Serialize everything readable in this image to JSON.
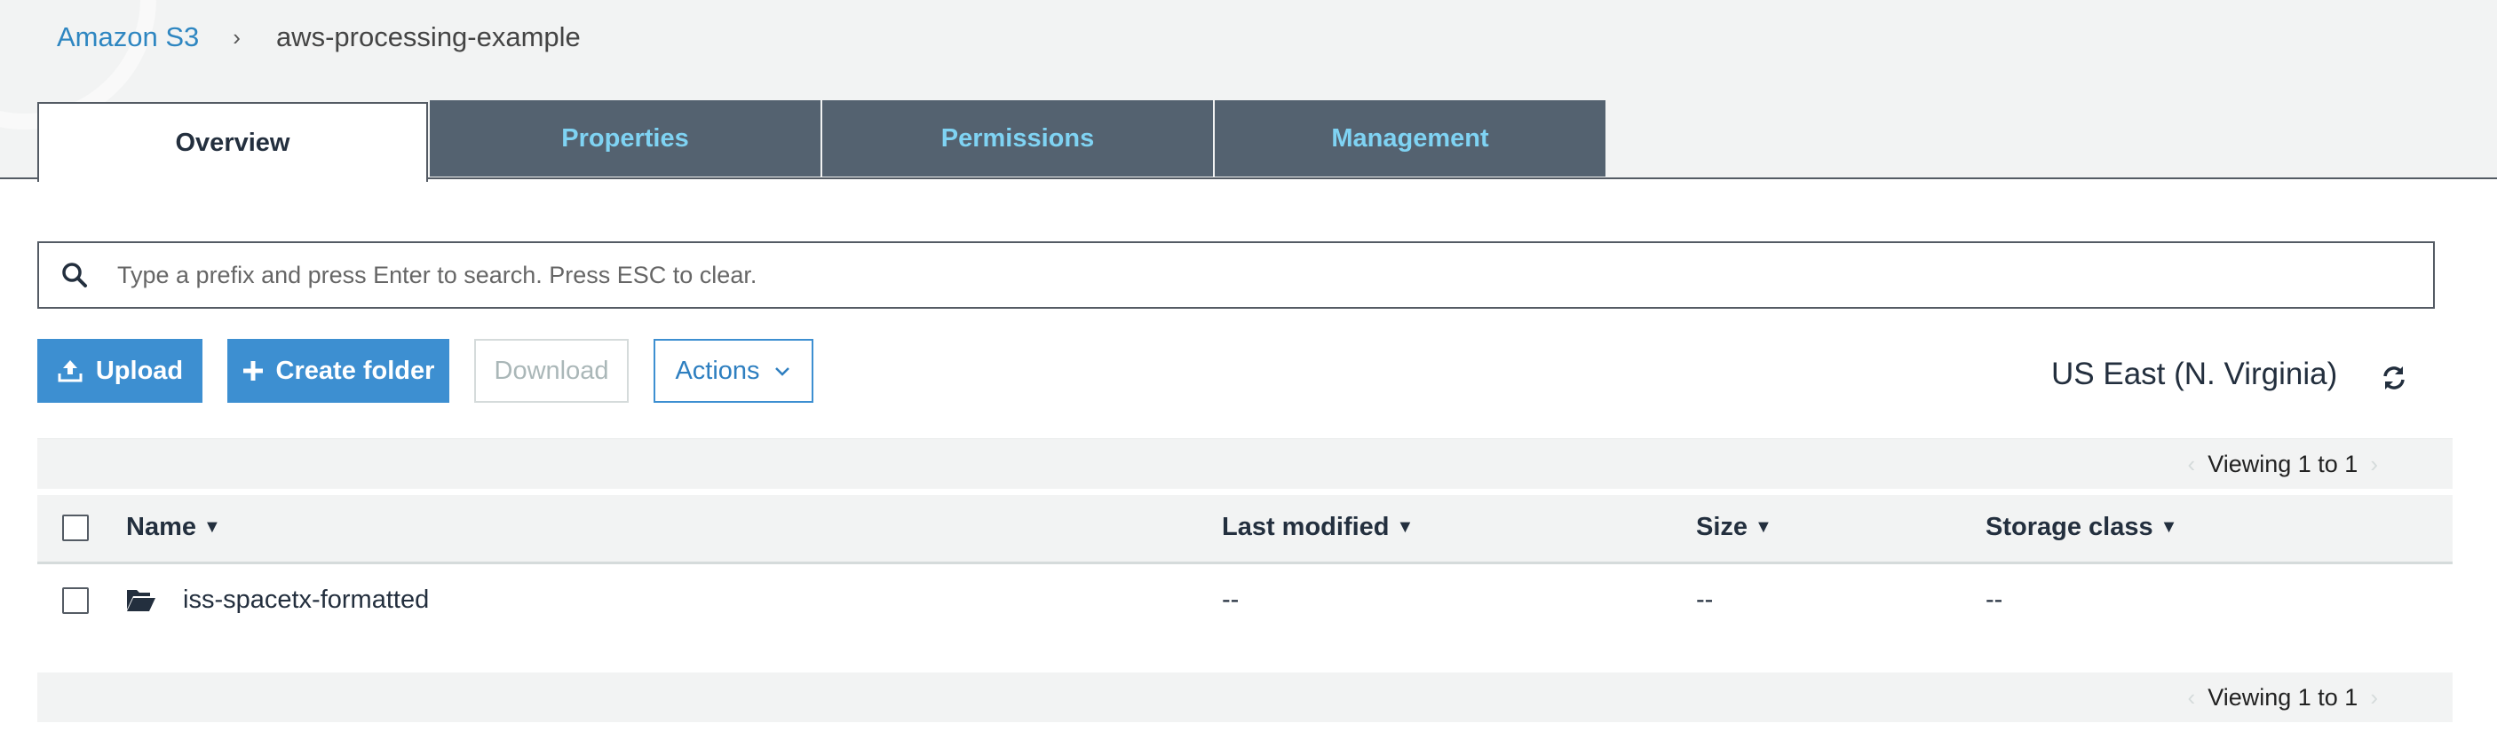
{
  "breadcrumb": {
    "root": "Amazon S3",
    "separator": "›",
    "current": "aws-processing-example"
  },
  "tabs": [
    {
      "label": "Overview",
      "active": true
    },
    {
      "label": "Properties",
      "active": false
    },
    {
      "label": "Permissions",
      "active": false
    },
    {
      "label": "Management",
      "active": false
    }
  ],
  "search": {
    "placeholder": "Type a prefix and press Enter to search. Press ESC to clear.",
    "value": ""
  },
  "toolbar": {
    "upload": "Upload",
    "create_folder": "Create folder",
    "download": "Download",
    "actions": "Actions",
    "region": "US East (N. Virginia)"
  },
  "pagination": {
    "top": "Viewing 1 to 1",
    "bottom": "Viewing 1 to 1"
  },
  "table": {
    "columns": [
      "Name",
      "Last modified",
      "Size",
      "Storage class"
    ],
    "rows": [
      {
        "name": "iss-spacetx-formatted",
        "last_modified": "--",
        "size": "--",
        "storage_class": "--",
        "type": "folder"
      }
    ]
  },
  "colors": {
    "accent": "#3d8fd1",
    "tab_inactive_bg": "#546270",
    "tab_inactive_text": "#7fd3f3",
    "link": "#2e86c1"
  },
  "icons": [
    "search-icon",
    "upload-icon",
    "plus-icon",
    "chevron-down-icon",
    "refresh-icon",
    "folder-open-icon",
    "chevron-left-icon",
    "chevron-right-icon",
    "sort-caret-icon"
  ]
}
